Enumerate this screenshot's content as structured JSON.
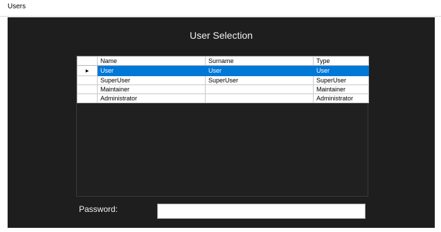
{
  "window": {
    "title": "Users"
  },
  "heading": "User Selection",
  "table": {
    "columns": [
      "Name",
      "Surname",
      "Type"
    ],
    "rows": [
      {
        "name": "User",
        "surname": "User",
        "type": "User",
        "selected": true
      },
      {
        "name": "SuperUser",
        "surname": "SuperUser",
        "type": "SuperUser",
        "selected": false
      },
      {
        "name": "Maintainer",
        "surname": "",
        "type": "Maintainer",
        "selected": false
      },
      {
        "name": "Administrator",
        "surname": "",
        "type": "Administrator",
        "selected": false
      }
    ],
    "row_indicator_icon": "row-arrow-icon"
  },
  "password": {
    "label": "Password:",
    "value": ""
  },
  "colors": {
    "background": "#1e1e1e",
    "selection": "#0078d7",
    "text_light": "#f0f0f0"
  }
}
